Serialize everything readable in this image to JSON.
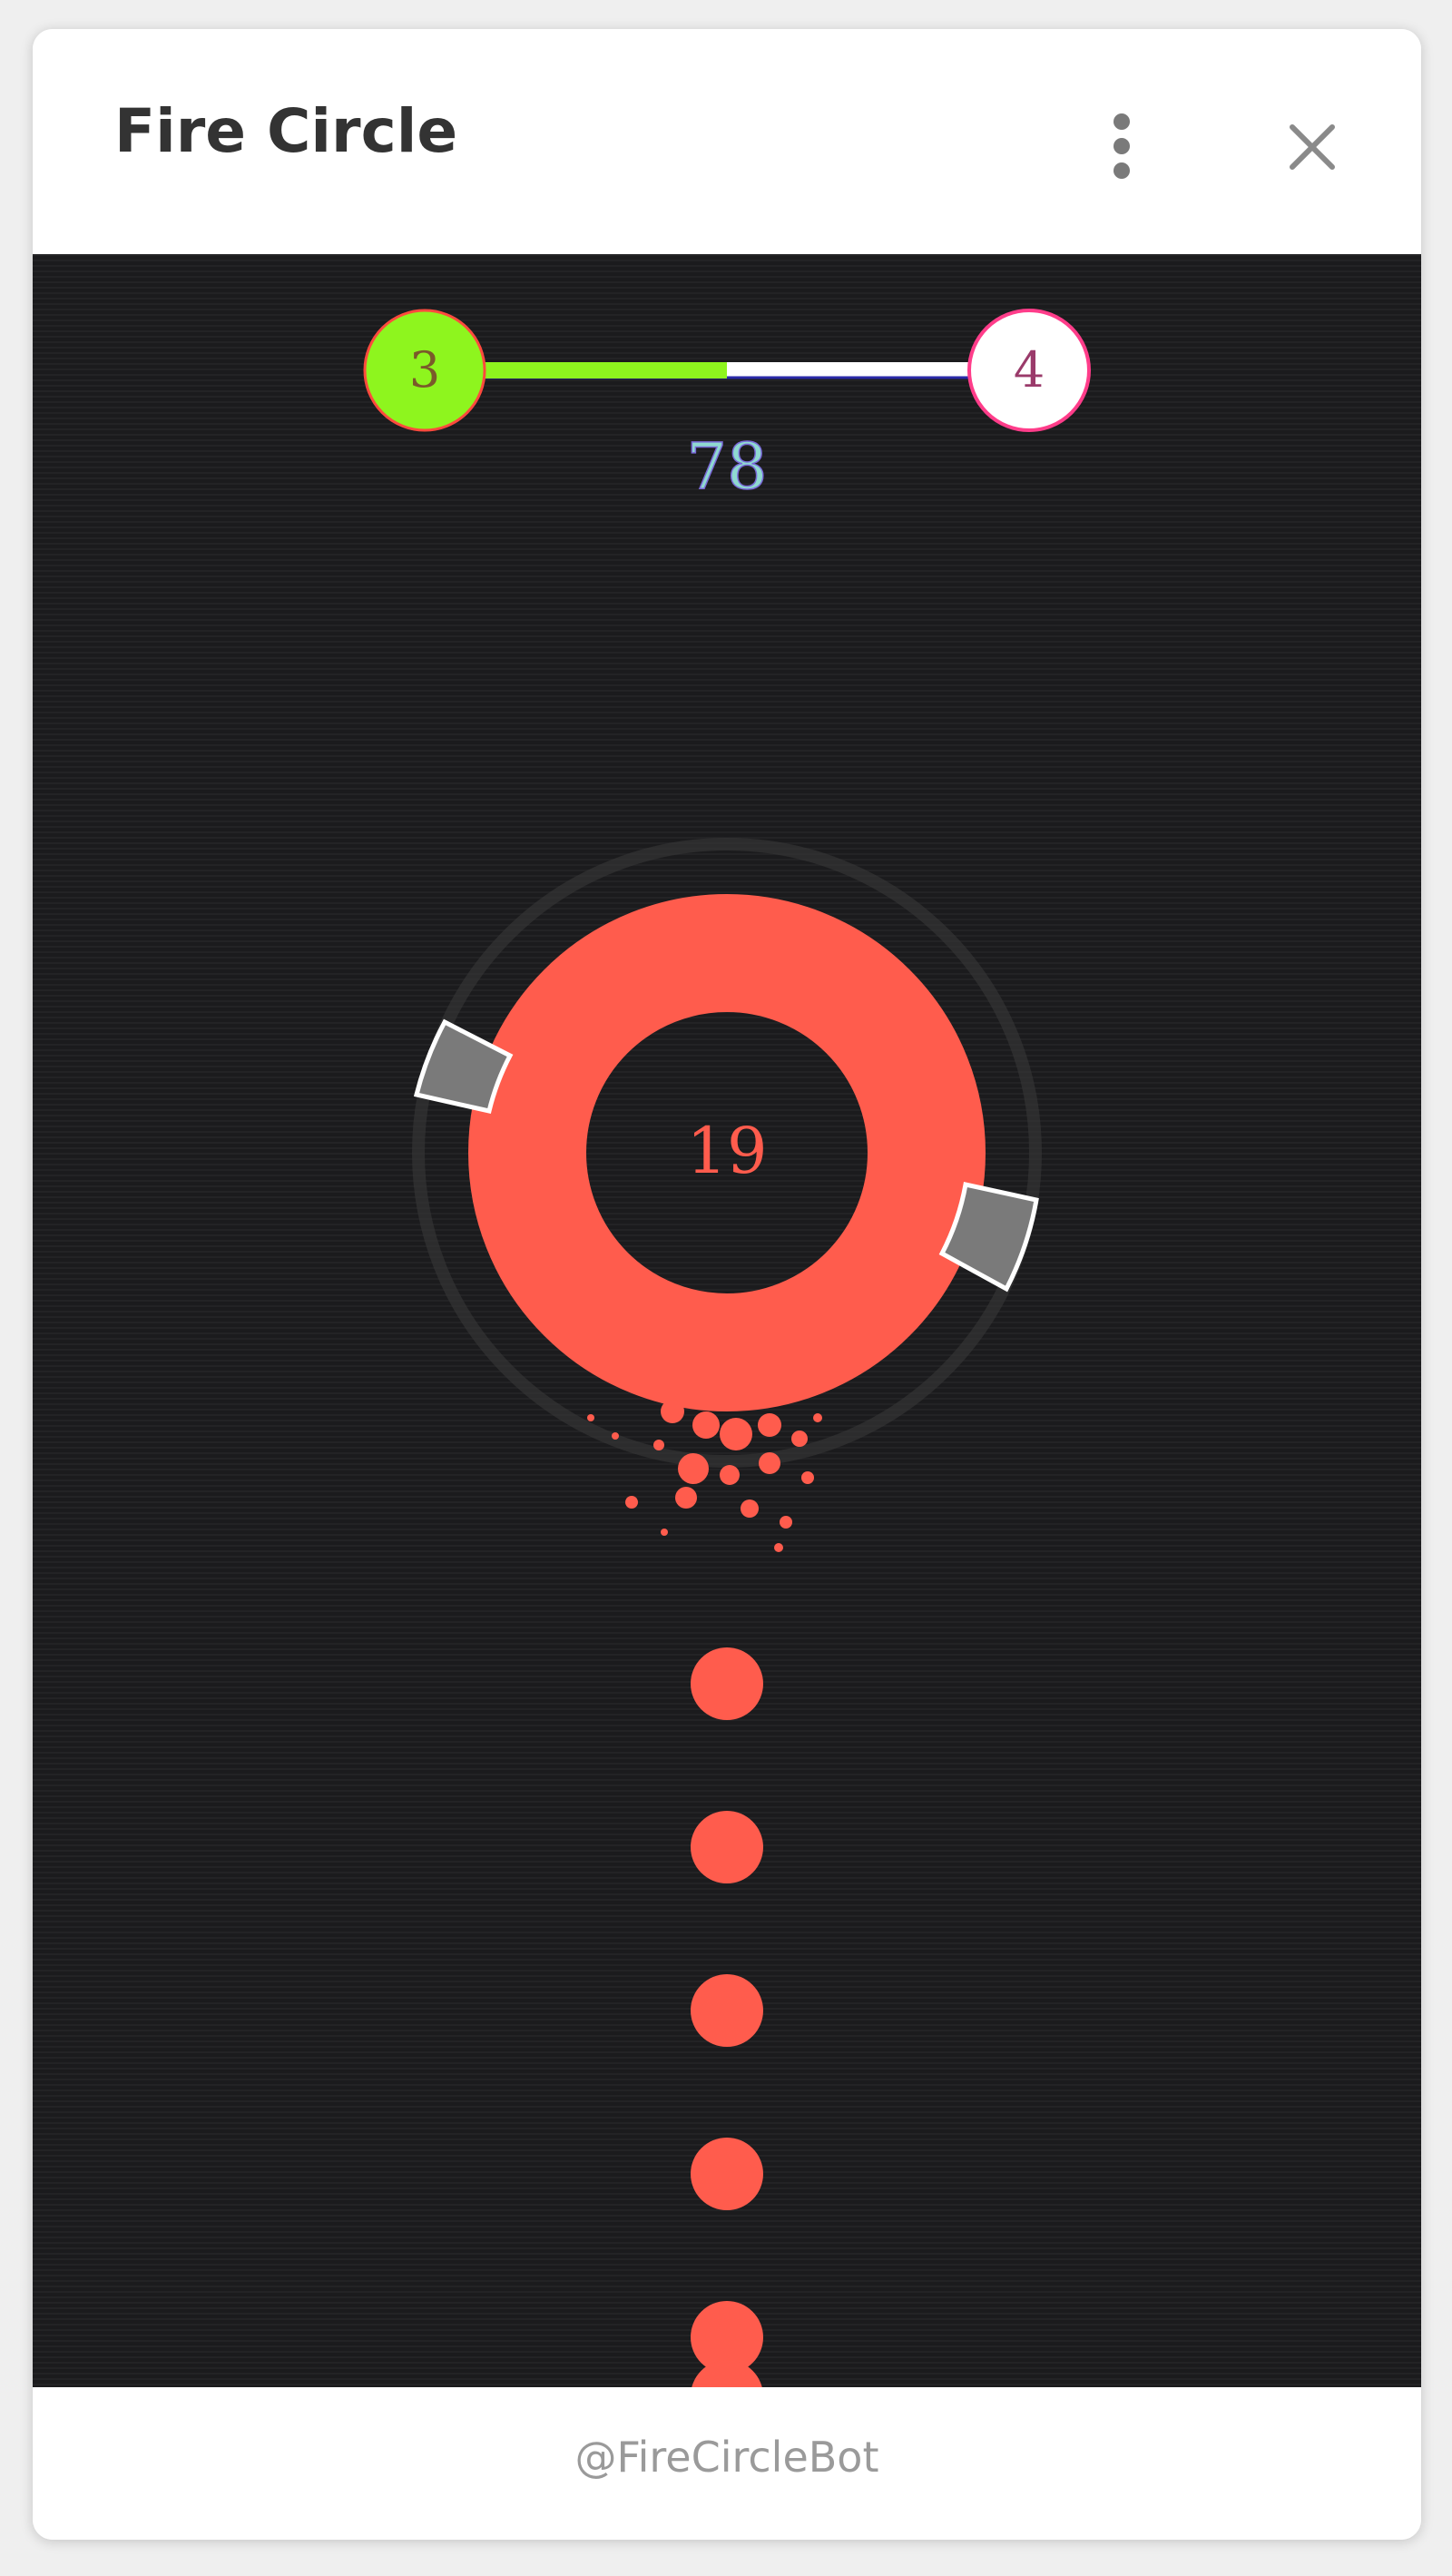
{
  "window": {
    "title": "Fire Circle",
    "footer": "@FireCircleBot"
  },
  "icons": {
    "menu": "vertical-dots-icon",
    "close": "close-x-icon"
  },
  "game": {
    "current_level": "3",
    "next_level": "4",
    "level_progress": 0.5,
    "score": "78",
    "target_hits_remaining": "19",
    "colors": {
      "background": "#1b1b1d",
      "accent_green": "#8ef51e",
      "ring": "#ff5c4d",
      "shield": "#7a7a7a",
      "progress_empty": "#ffffff"
    }
  }
}
